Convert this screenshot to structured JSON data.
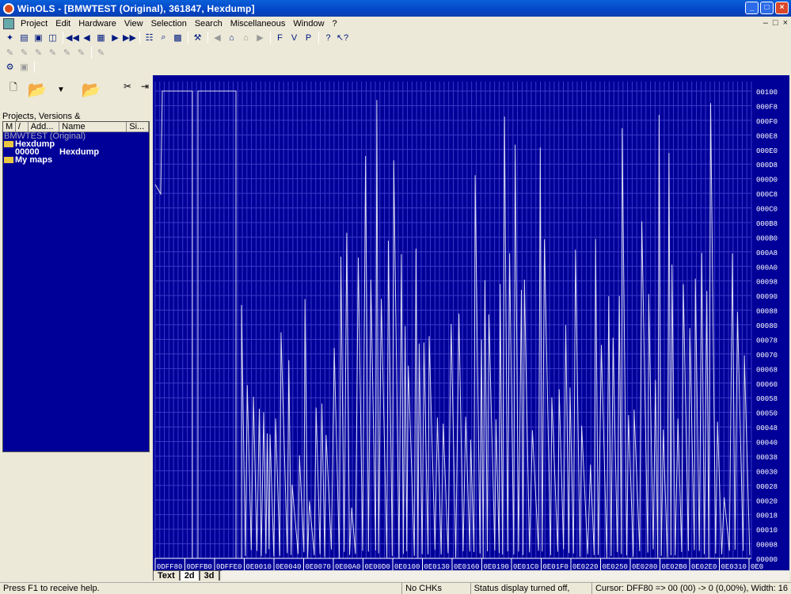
{
  "window": {
    "title": "WinOLS - [BMWTEST (Original), 361847, Hexdump]",
    "buttons": [
      "_",
      "□",
      "×"
    ]
  },
  "menu": {
    "items": [
      "Project",
      "Edit",
      "Hardware",
      "View",
      "Selection",
      "Search",
      "Miscellaneous",
      "Window",
      "?"
    ],
    "mdi_buttons": [
      "–",
      "□",
      "×"
    ]
  },
  "panel": {
    "projects_label": "Projects, Versions &",
    "columns": [
      "M",
      "/",
      "Add...",
      "Name",
      "Si..."
    ],
    "tree": {
      "project": "BMWTEST (Original)",
      "folder1": "Hexdump",
      "row_addr": "00000",
      "row_name": "Hexdump",
      "folder2": "My maps"
    }
  },
  "chart_data": {
    "type": "line",
    "title": "",
    "xlabel": "",
    "ylabel": "",
    "x_tick_labels": [
      "0DFF80",
      "0DFFB0",
      "0DFFE0",
      "0E0010",
      "0E0040",
      "0E0070",
      "0E00A0",
      "0E00D0",
      "0E0100",
      "0E0130",
      "0E0160",
      "0E0190",
      "0E01C0",
      "0E01F0",
      "0E0220",
      "0E0250",
      "0E0280",
      "0E02B0",
      "0E02E0",
      "0E0310",
      "0E0"
    ],
    "y_tick_labels": [
      "00100",
      "000F8",
      "000F0",
      "000E8",
      "000E0",
      "000D8",
      "000D0",
      "000C8",
      "000C0",
      "000B8",
      "000B0",
      "000A8",
      "000A0",
      "00098",
      "00090",
      "00088",
      "00080",
      "00078",
      "00070",
      "00068",
      "00060",
      "00058",
      "00050",
      "00048",
      "00040",
      "00038",
      "00030",
      "00028",
      "00020",
      "00018",
      "00010",
      "00008",
      "00000"
    ],
    "ylim": [
      0,
      256
    ],
    "grid": true,
    "series_color": "#ffffff",
    "background": "#000099"
  },
  "tabs": [
    "Text",
    "2d",
    "3d"
  ],
  "status": {
    "help": "Press F1 to receive help.",
    "chk": "No CHKs",
    "display": "Status display turned off,",
    "cursor": "Cursor: DFF80 => 00 (00) -> 0 (0,00%), Width: 16"
  }
}
